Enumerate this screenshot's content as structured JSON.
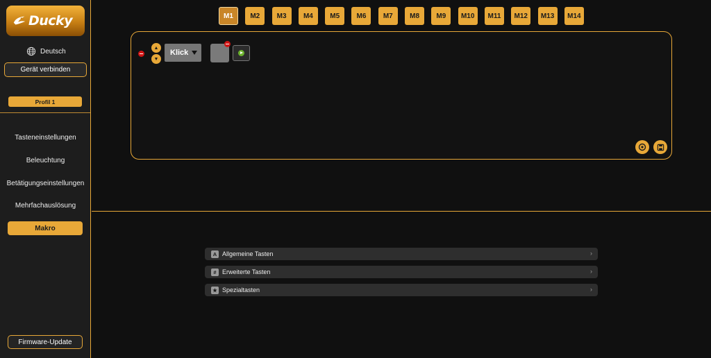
{
  "sidebar": {
    "brand": "Ducky",
    "language": "Deutsch",
    "connect_label": "Gerät verbinden",
    "profile_label": "Profil 1",
    "nav": [
      "Tasteneinstellungen",
      "Beleuchtung",
      "Betätigungseinstellungen",
      "Mehrfachauslösung",
      "Makro"
    ],
    "active_nav": "Makro",
    "firmware_label": "Firmware-Update"
  },
  "macro_tabs": [
    "M1",
    "M2",
    "M3",
    "M4",
    "M5",
    "M6",
    "M7",
    "M8",
    "M9",
    "M10",
    "M11",
    "M12",
    "M13",
    "M14"
  ],
  "active_macro_tab": "M1",
  "editor": {
    "action_type": "Klick"
  },
  "key_categories": [
    {
      "icon": "A",
      "label": "Allgemeine Tasten"
    },
    {
      "icon": "#",
      "label": "Erweiterte Tasten"
    },
    {
      "icon": "★",
      "label": "Spezialtasten"
    }
  ],
  "colors": {
    "accent": "#e8a838",
    "background": "#101010",
    "sidebar": "#1d1d1d"
  }
}
